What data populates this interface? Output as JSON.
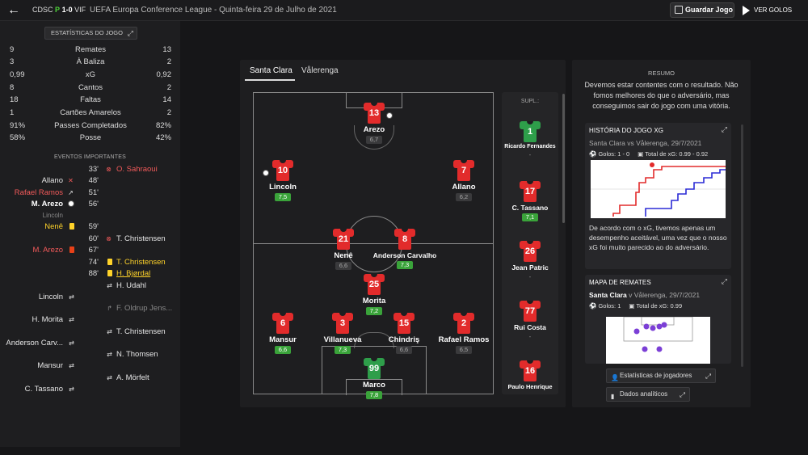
{
  "header": {
    "home_abbr": "CDSC",
    "result_letter": "P",
    "score": "1-0",
    "away_abbr": "VIF",
    "competition": "UEFA Europa Conference League - Quinta-feira 29 de Julho de 2021",
    "save_label": "Guardar Jogo",
    "goals_label": "VER GOLOS"
  },
  "stats": {
    "button_label": "ESTATÍSTICAS DO JOGO",
    "rows": [
      {
        "away": "9",
        "label": "Remates",
        "home": "13"
      },
      {
        "away": "3",
        "label": "À Baliza",
        "home": "2"
      },
      {
        "away": "0,99",
        "label": "xG",
        "home": "0,92"
      },
      {
        "away": "8",
        "label": "Cantos",
        "home": "2"
      },
      {
        "away": "18",
        "label": "Faltas",
        "home": "14"
      },
      {
        "away": "1",
        "label": "Cartões Amarelos",
        "home": "2"
      },
      {
        "away": "91%",
        "label": "Passes Completados",
        "home": "82%"
      },
      {
        "away": "58%",
        "label": "Posse",
        "home": "42%"
      }
    ]
  },
  "events": {
    "title": "EVENTOS IMPORTANTES",
    "minutes": [
      "33'",
      "48'",
      "51'",
      "56'",
      "59'",
      "60'",
      "67'",
      "74'",
      "88'"
    ],
    "left": [
      {
        "text": "Allano",
        "icon": "cross-icon"
      },
      {
        "text": "Rafael Ramos",
        "icon": "sub-out-icon"
      },
      {
        "text": "M. Arezo",
        "sub": "Lincoln",
        "icon": "goal-icon"
      },
      {
        "text": "Nenê",
        "icon": "yellow-card-icon"
      },
      {
        "text": "M. Arezo",
        "icon": "red-card-icon"
      },
      {
        "text": "Lincoln",
        "icon": "sub-icon"
      },
      {
        "text": "H. Morita",
        "icon": "sub-icon"
      },
      {
        "text": "Anderson Carv...",
        "icon": "sub-icon"
      },
      {
        "text": "Mansur",
        "icon": "sub-icon"
      },
      {
        "text": "C. Tassano",
        "icon": "sub-icon"
      }
    ],
    "right": [
      {
        "text": "O. Sahraoui",
        "icon": "miss-icon"
      },
      {
        "text": "T. Christensen",
        "icon": "chance-icon"
      },
      {
        "text": "T. Christensen",
        "icon": "yellow-card-icon"
      },
      {
        "text": "H. Bjørdal",
        "icon": "yellow-card-icon"
      },
      {
        "text": "H. Udahl",
        "icon": "sub-icon"
      },
      {
        "text": "F. Oldrup Jens...",
        "icon": "sub-out-icon"
      },
      {
        "text": "T. Christensen",
        "icon": "sub-icon"
      },
      {
        "text": "N. Thomsen",
        "icon": "sub-icon"
      },
      {
        "text": "A. Mörfelt",
        "icon": "sub-icon"
      }
    ]
  },
  "lineup": {
    "tabs": [
      "Santa Clara",
      "Vålerenga"
    ],
    "players": [
      {
        "number": "13",
        "name": "Arezo",
        "rating": "6,7",
        "good": false
      },
      {
        "number": "10",
        "name": "Lincoln",
        "rating": "7,5",
        "good": true
      },
      {
        "number": "7",
        "name": "Allano",
        "rating": "6,2",
        "good": false
      },
      {
        "number": "21",
        "name": "Nenê",
        "rating": "6,6",
        "good": false
      },
      {
        "number": "8",
        "name": "Anderson Carvalho",
        "rating": "7,3",
        "good": true
      },
      {
        "number": "25",
        "name": "Morita",
        "rating": "7,2",
        "good": true
      },
      {
        "number": "6",
        "name": "Mansur",
        "rating": "6,6",
        "good": true
      },
      {
        "number": "3",
        "name": "Villanueva",
        "rating": "7,3",
        "good": true
      },
      {
        "number": "15",
        "name": "Chindriş",
        "rating": "6,6",
        "good": false
      },
      {
        "number": "2",
        "name": "Rafael Ramos",
        "rating": "6,5",
        "good": false
      },
      {
        "number": "99",
        "name": "Marco",
        "rating": "7,8",
        "good": true
      }
    ],
    "subs_label": "SUPL.:",
    "subs": [
      {
        "number": "1",
        "name": "Ricardo Fernandes",
        "rating": "-"
      },
      {
        "number": "17",
        "name": "C. Tassano",
        "rating": "7,1"
      },
      {
        "number": "26",
        "name": "Jean Patric",
        "rating": "-"
      },
      {
        "number": "77",
        "name": "Rui Costa",
        "rating": "-"
      },
      {
        "number": "16",
        "name": "Paulo Henrique",
        "rating": ""
      }
    ]
  },
  "summary": {
    "title": "RESUMO",
    "text": "Devemos estar contentes com o resultado. Não fomos melhores do que o adversário, mas conseguimos sair do jogo com uma vitória.",
    "xg_card": {
      "title": "HISTÓRIA DO JOGO XG",
      "match": "Santa Clara vs Vålerenga, 29/7/2021",
      "goals": "Golos: 1 - 0",
      "xg_total": "Total de xG: 0.99 - 0.92",
      "text": "De acordo com o xG, tivemos apenas um desempenho aceitável, uma vez que o nosso xG foi muito parecido ao do adversário."
    },
    "shots_card": {
      "title": "MAPA DE REMATES",
      "team": "Santa Clara",
      "match": "v Vålerenga, 29/7/2021",
      "goals": "Golos: 1",
      "xg_total": "Total de xG: 0.99"
    },
    "btn_players": "Estatísticas de jogadores",
    "btn_analytics": "Dados analíticos"
  },
  "colors": {
    "home": "#e22b2b",
    "away": "#2b2bd6",
    "good_rating": "#3aa33a"
  }
}
